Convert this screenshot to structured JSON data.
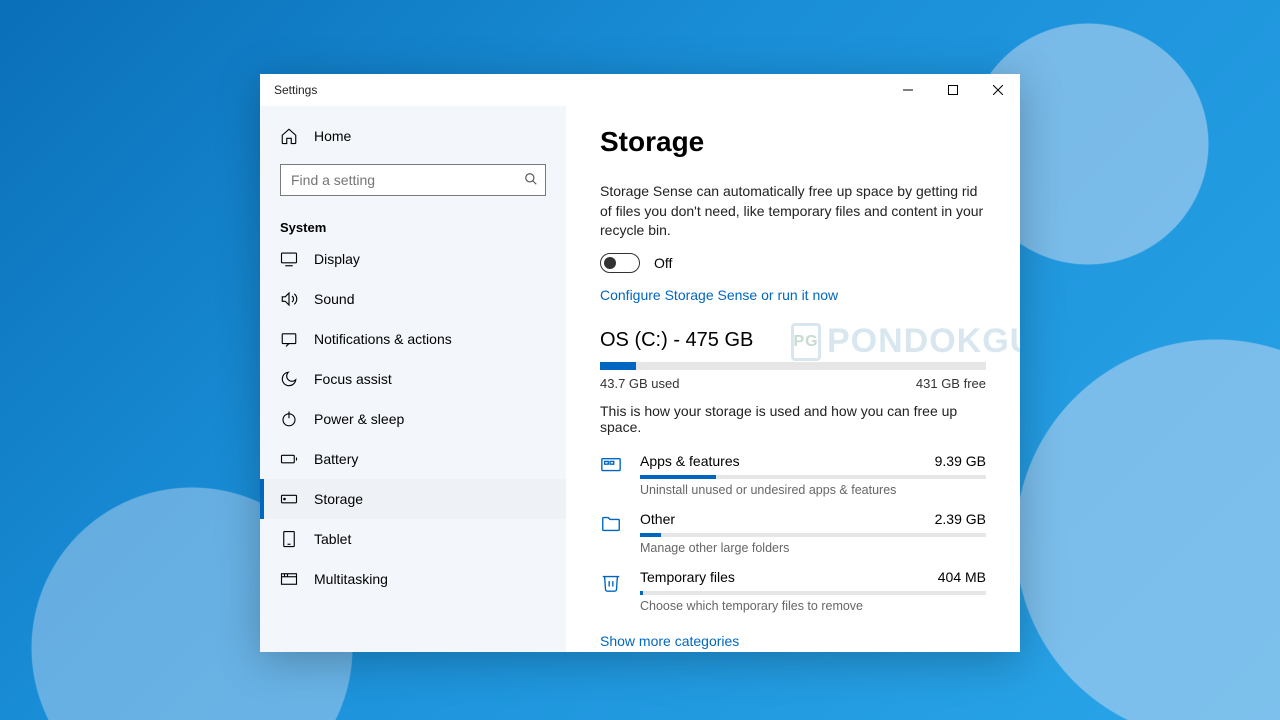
{
  "window": {
    "title": "Settings"
  },
  "sidebar": {
    "home": "Home",
    "search_placeholder": "Find a setting",
    "section": "System",
    "items": [
      {
        "label": "Display"
      },
      {
        "label": "Sound"
      },
      {
        "label": "Notifications & actions"
      },
      {
        "label": "Focus assist"
      },
      {
        "label": "Power & sleep"
      },
      {
        "label": "Battery"
      },
      {
        "label": "Storage",
        "active": true
      },
      {
        "label": "Tablet"
      },
      {
        "label": "Multitasking"
      }
    ]
  },
  "main": {
    "heading": "Storage",
    "sense_desc": "Storage Sense can automatically free up space by getting rid of files you don't need, like temporary files and content in your recycle bin.",
    "toggle_state": "Off",
    "configure_link": "Configure Storage Sense or run it now",
    "drive": {
      "title": "OS (C:) - 475 GB",
      "used_label": "43.7 GB used",
      "free_label": "431 GB free",
      "used_pct": 9.2,
      "desc": "This is how your storage is used and how you can free up space."
    },
    "categories": [
      {
        "name": "Apps & features",
        "size": "9.39 GB",
        "pct": 22,
        "sub": "Uninstall unused or undesired apps & features"
      },
      {
        "name": "Other",
        "size": "2.39 GB",
        "pct": 6,
        "sub": "Manage other large folders"
      },
      {
        "name": "Temporary files",
        "size": "404 MB",
        "pct": 1,
        "sub": "Choose which temporary files to remove"
      }
    ],
    "show_more": "Show more categories"
  },
  "watermark": "PONDOKGUE"
}
